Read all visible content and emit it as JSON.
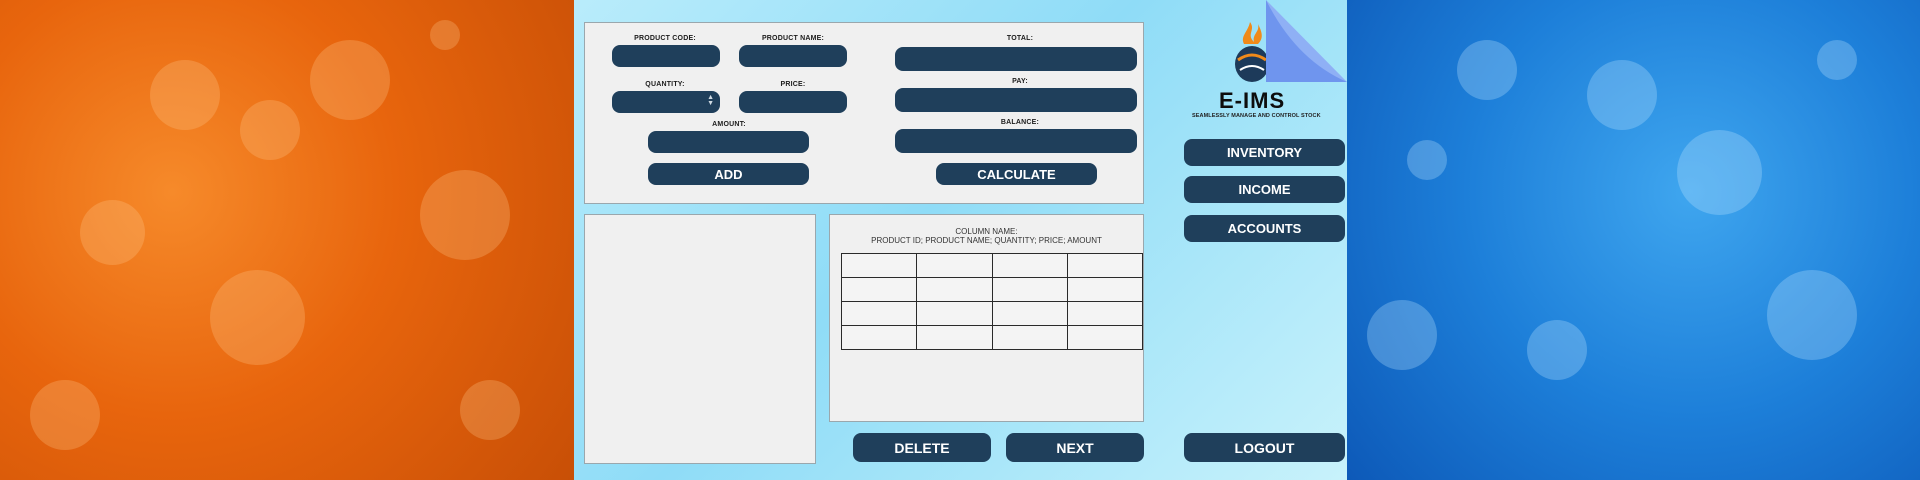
{
  "brand": {
    "title": "E-IMS",
    "subtitle": "SEAMLESSLY MANAGE AND CONTROL STOCK"
  },
  "form": {
    "product_code_label": "PRODUCT CODE:",
    "product_name_label": "PRODUCT NAME:",
    "quantity_label": "QUANTITY:",
    "price_label": "PRICE:",
    "amount_label": "AMOUNT:",
    "total_label": "TOTAL:",
    "pay_label": "PAY:",
    "balance_label": "BALANCE:",
    "add_button": "ADD",
    "calculate_button": "CALCULATE"
  },
  "table": {
    "column_name_title": "COLUMN NAME:",
    "column_name_list": "PRODUCT ID; PRODUCT NAME; QUANTITY; PRICE; AMOUNT"
  },
  "nav": {
    "inventory": "INVENTORY",
    "income": "INCOME",
    "accounts": "ACCOUNTS",
    "logout": "LOGOUT"
  },
  "actions": {
    "delete": "DELETE",
    "next": "NEXT"
  },
  "colors": {
    "primary_button": "#1f3f5b",
    "panel": "#f0f0f0",
    "left_background": "#e8650d",
    "right_background": "#1d7fd9"
  }
}
